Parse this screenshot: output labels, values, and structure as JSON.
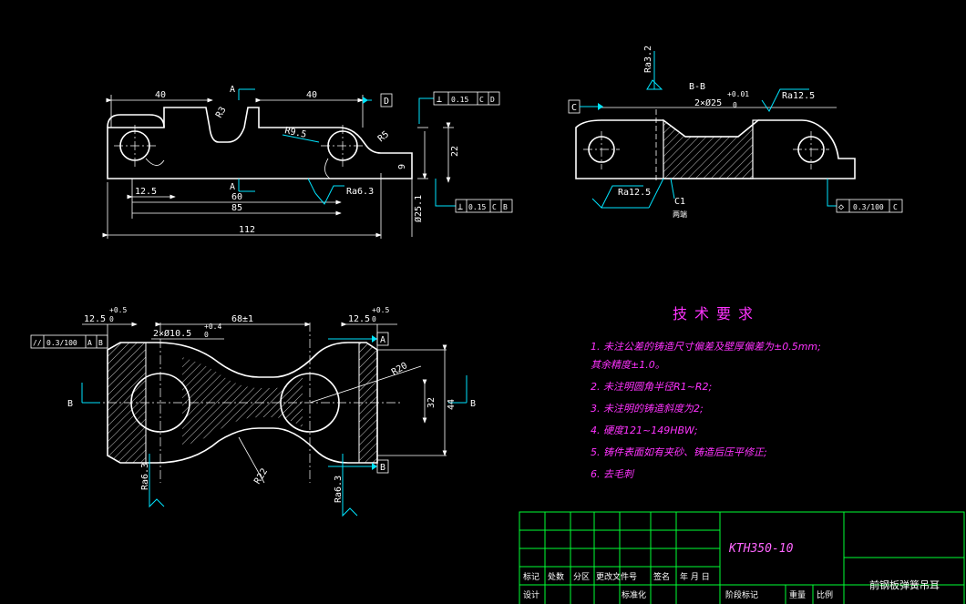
{
  "view_top": {
    "dim_40_left": "40",
    "dim_40_right": "40",
    "section_mark_top": "A",
    "section_mark_bottom": "A",
    "dim_r3": "R3",
    "dim_r95": "R9.5",
    "dim_r5": "R5",
    "dim_125": "12.5",
    "dim_60": "60",
    "dim_85": "85",
    "dim_112": "112",
    "dim_22": "22",
    "dim_9": "9",
    "dim_phi": "Ø25.1",
    "rough_ra63": "Ra6.3",
    "datum_d": "D",
    "fcf_top": [
      "⊥",
      "0.15",
      "C",
      "D"
    ],
    "fcf_bottom": [
      "⊥",
      "0.15",
      "C",
      "B"
    ]
  },
  "view_section": {
    "title": "B-B",
    "holes": "2×Ø25",
    "tol_upper": "+0.01",
    "tol_lower": "0",
    "rough_top": "Ra12.5",
    "rough_left": "Ra12.5",
    "rough_vert": "Ra3.2",
    "datum_c": "C",
    "chamfer": "C1",
    "chamfer_note": "两端",
    "fcf": [
      "◇",
      "0.3/100",
      "C"
    ]
  },
  "view_plan": {
    "dim_125_left": "12.5",
    "dim_125_right": "12.5",
    "tol_pos": "+0.5",
    "tol_zero": "0",
    "dim_center": "68±1",
    "holes": "2×Ø10.5",
    "holes_tol_u": "+0.4",
    "holes_tol_l": "0",
    "dim_r20": "R20",
    "dim_r22": "R22",
    "dim_32": "32",
    "dim_44": "44",
    "rough_left": "Ra6.3",
    "rough_right": "Ra6.3",
    "datum_a": "A",
    "datum_b": "B",
    "section_b": "B",
    "fcf": [
      "//",
      "0.3/100",
      "A",
      "B"
    ]
  },
  "requirements": {
    "title": "技术要求",
    "items": [
      "1. 未注公差的铸造尺寸偏差及壁厚偏差为±0.5mm;",
      "其余精度±1.0。",
      "2. 未注明圆角半径R1~R2;",
      "3. 未注明的铸造斜度为2;",
      "4. 硬度121~149HBW;",
      "5. 铸件表面如有夹砂、铸造后压平修正;",
      "6. 去毛刺"
    ]
  },
  "title_block": {
    "part_code": "KTH350-10",
    "part_name": "前钢板弹簧吊耳",
    "row_labels": [
      "标记",
      "处数",
      "分区",
      "更改文件号",
      "签名",
      "年 月 日"
    ],
    "design": "设计",
    "standard": "标准化",
    "stage": "阶段标记",
    "weight": "重量",
    "scale": "比例"
  },
  "colors": {
    "outline": "#ffffff",
    "leader": "#00e5ff",
    "center": "#ffffff",
    "title_block": "#00ff33",
    "text_accent": "#ff33ff",
    "hatch": "#ffffff"
  }
}
